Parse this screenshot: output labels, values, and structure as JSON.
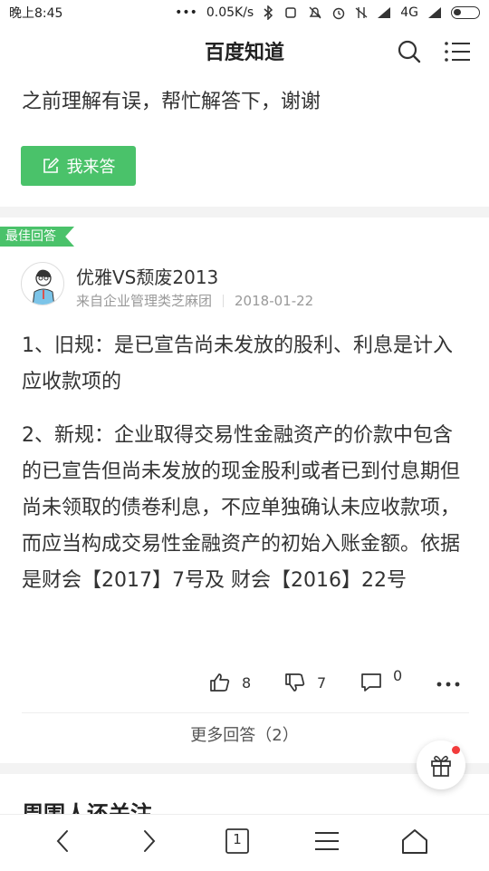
{
  "status_bar": {
    "time": "晚上8:45",
    "network_speed": "0.05K/s",
    "network_type": "4G"
  },
  "header": {
    "title": "百度知道"
  },
  "question": {
    "text": "之前理解有误，帮忙解答下，谢谢",
    "answer_button_label": "我来答"
  },
  "best_answer": {
    "tag": "最佳回答",
    "username": "优雅VS颓废2013",
    "source": "来自企业管理类芝麻团",
    "date": "2018-01-22",
    "paragraphs": [
      "1、旧规：是已宣告尚未发放的股利、利息是计入应收款项的",
      "2、新规：企业取得交易性金融资产的价款中包含的已宣告但尚未发放的现金股利或者已到付息期但尚未领取的债卷利息，不应单独确认未应收款项，而应当构成交易性金融资产的初始入账金额。依据是财会【2017】7号及 财会【2016】22号"
    ],
    "likes": "8",
    "dislikes": "7",
    "comments": "0"
  },
  "more_answers": "更多回答（2）",
  "next_section_title": "周围人还关注",
  "bottom_nav": {
    "tab_count": "1"
  },
  "colors": {
    "accent_green": "#4ac26a",
    "notification_red": "#f23c3c"
  }
}
